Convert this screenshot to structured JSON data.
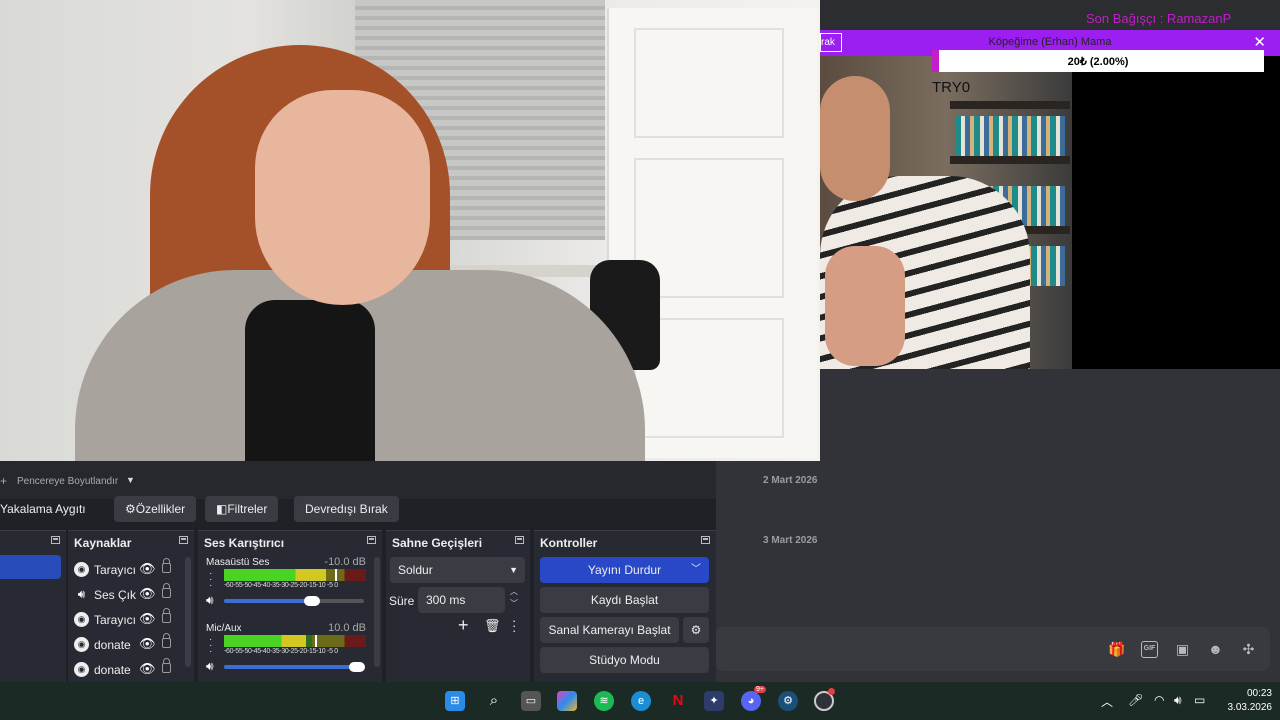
{
  "overlay": {
    "top_title": "Son Bağışçı :  RamazanP",
    "donation_button": "rak",
    "donation_title": "Köpeğime (Erhan) Mama",
    "donation_close": "✕",
    "progress_text": "20₺ (2.00%)",
    "progress_fraction": 0.02,
    "camera_label": "TRY0"
  },
  "chat": {
    "date1": "2 Mart 2026",
    "date2": "3 Mart 2026",
    "icons": [
      "gift-icon",
      "gif-icon",
      "sticker-icon",
      "emoji-icon",
      "apps-icon"
    ],
    "gif_label": "GIF"
  },
  "obs": {
    "resize_label": "Pencereye Boyutlandır",
    "plus": "+",
    "capture_label": "Yakalama Aygıtı",
    "properties_label": "Özellikler",
    "filters_label": "Filtreler",
    "deactivate_label": "Devredışı Bırak",
    "docks": {
      "sources_title": "Kaynaklar",
      "mixer_title": "Ses Karıştırıcı",
      "transitions_title": "Sahne Geçişleri",
      "controls_title": "Kontroller"
    },
    "sources": [
      {
        "name": "Tarayıcı",
        "icon": "browser-icon"
      },
      {
        "name": "Ses Çıkışı",
        "icon": "speaker-icon"
      },
      {
        "name": "Tarayıcı",
        "icon": "browser-icon"
      },
      {
        "name": "donate",
        "icon": "browser-icon"
      },
      {
        "name": "donate",
        "icon": "browser-icon"
      }
    ],
    "mixer": [
      {
        "name": "Masaüstü Ses",
        "db": "-10.0 dB",
        "level": 0.72,
        "volume": 0.63
      },
      {
        "name": "Mic/Aux",
        "db": "10.0 dB",
        "level": 0.58,
        "volume": 0.95
      }
    ],
    "scale": "-60-55-50-45-40-35-30-25-20-15-10 -5  0",
    "transition": {
      "type": "Soldur",
      "duration_label": "Süre",
      "duration_value": "300 ms"
    },
    "controls": {
      "stop_stream": "Yayını Durdur",
      "start_record": "Kaydı Başlat",
      "virtual_cam": "Sanal Kamerayı Başlat",
      "studio_mode": "Stüdyo Modu"
    }
  },
  "taskbar": {
    "apps": [
      "windows-start-icon",
      "search-icon",
      "task-view-icon",
      "copilot-icon",
      "spotify-icon",
      "edge-icon",
      "netflix-icon",
      "app-icon",
      "discord-icon",
      "steam-icon",
      "obs-icon"
    ],
    "discord_badge": "9+",
    "time": "00:23",
    "date": "3.03.2026"
  }
}
